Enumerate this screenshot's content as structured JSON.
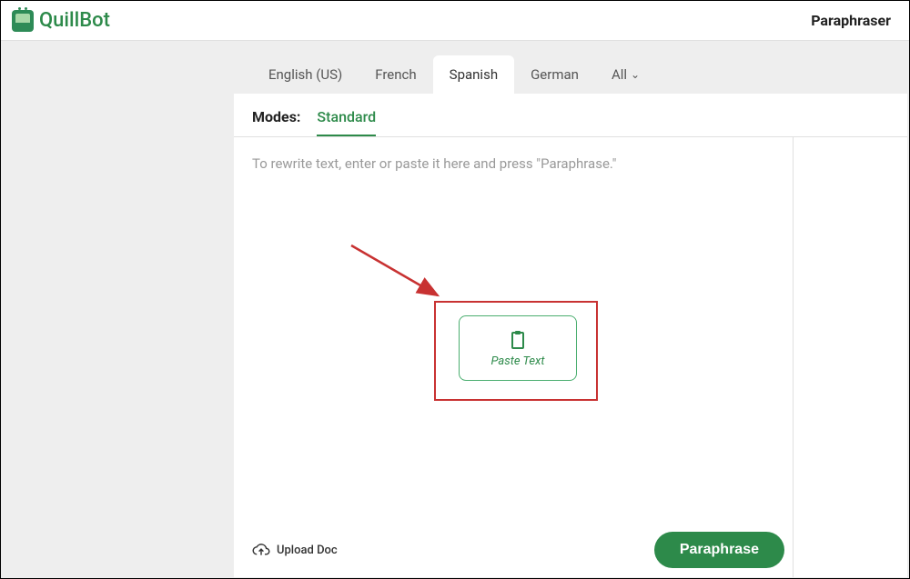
{
  "brand": {
    "name": "QuillBot"
  },
  "page": {
    "title": "Paraphraser"
  },
  "languages": [
    {
      "label": "English (US)",
      "active": false
    },
    {
      "label": "French",
      "active": false
    },
    {
      "label": "Spanish",
      "active": true
    },
    {
      "label": "German",
      "active": false
    }
  ],
  "all_label": "All",
  "modes": {
    "label": "Modes:",
    "active": "Standard"
  },
  "editor": {
    "placeholder": "To rewrite text, enter or paste it here and press \"Paraphrase.\""
  },
  "paste_button": {
    "label": "Paste Text"
  },
  "upload": {
    "label": "Upload Doc"
  },
  "actions": {
    "paraphrase": "Paraphrase"
  },
  "colors": {
    "accent": "#2d8a4a",
    "highlight_border": "#c83232"
  }
}
